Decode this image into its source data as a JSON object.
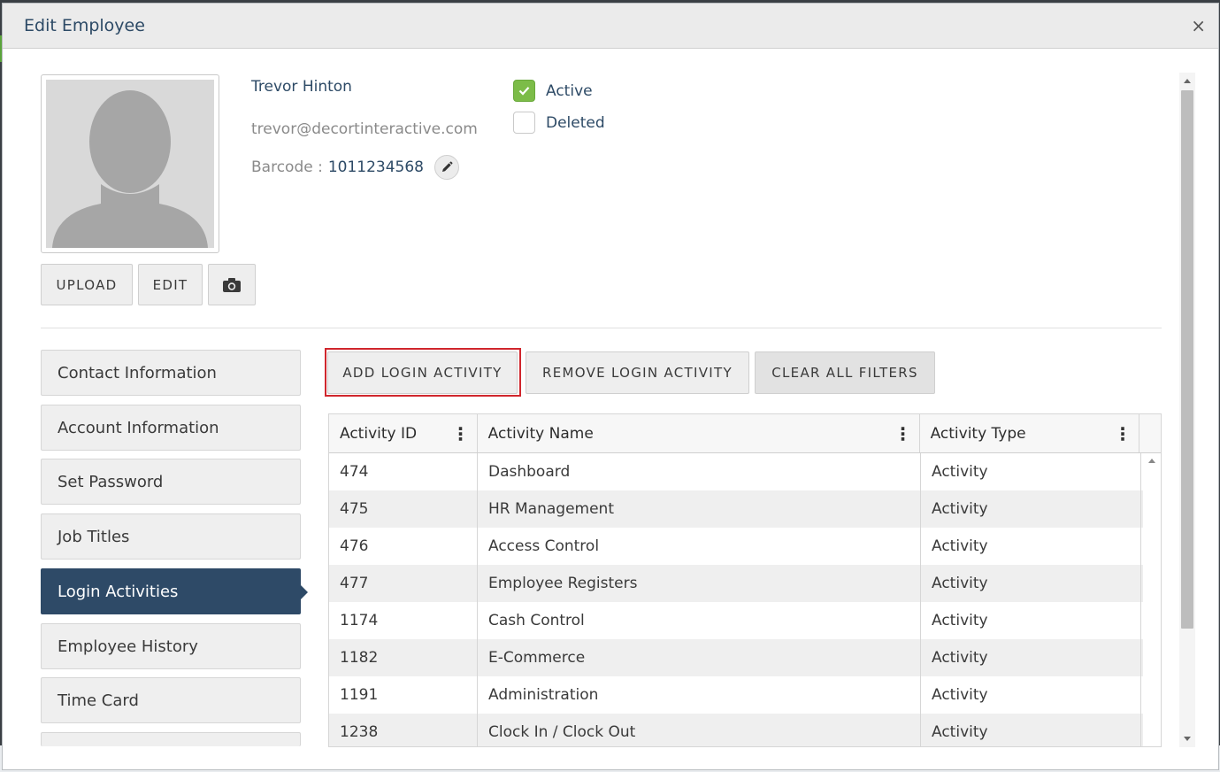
{
  "modal": {
    "title": "Edit Employee",
    "close_icon": "×"
  },
  "employee": {
    "name": "Trevor Hinton",
    "email": "trevor@decortinteractive.com",
    "barcode_label": "Barcode :",
    "barcode_value": "1011234568"
  },
  "photo_buttons": {
    "upload": "UPLOAD",
    "edit": "EDIT",
    "camera_icon": "camera-icon"
  },
  "status": {
    "active_label": "Active",
    "active_checked": true,
    "deleted_label": "Deleted",
    "deleted_checked": false
  },
  "nav": {
    "items": [
      {
        "label": "Contact Information"
      },
      {
        "label": "Account Information"
      },
      {
        "label": "Set Password"
      },
      {
        "label": "Job Titles"
      },
      {
        "label": "Login Activities"
      },
      {
        "label": "Employee History"
      },
      {
        "label": "Time Card"
      }
    ],
    "active_index": 4
  },
  "actions": {
    "add": "ADD LOGIN ACTIVITY",
    "remove": "REMOVE LOGIN ACTIVITY",
    "clear": "CLEAR ALL FILTERS"
  },
  "grid": {
    "columns": [
      "Activity ID",
      "Activity Name",
      "Activity Type"
    ],
    "rows": [
      [
        "474",
        "Dashboard",
        "Activity"
      ],
      [
        "475",
        "HR Management",
        "Activity"
      ],
      [
        "476",
        "Access Control",
        "Activity"
      ],
      [
        "477",
        "Employee Registers",
        "Activity"
      ],
      [
        "1174",
        "Cash Control",
        "Activity"
      ],
      [
        "1182",
        "E-Commerce",
        "Activity"
      ],
      [
        "1191",
        "Administration",
        "Activity"
      ],
      [
        "1238",
        "Clock In / Clock Out",
        "Activity"
      ]
    ]
  },
  "colors": {
    "primary": "#2e4a67",
    "check_green": "#7cbc48",
    "highlight_red": "#d0262d"
  }
}
